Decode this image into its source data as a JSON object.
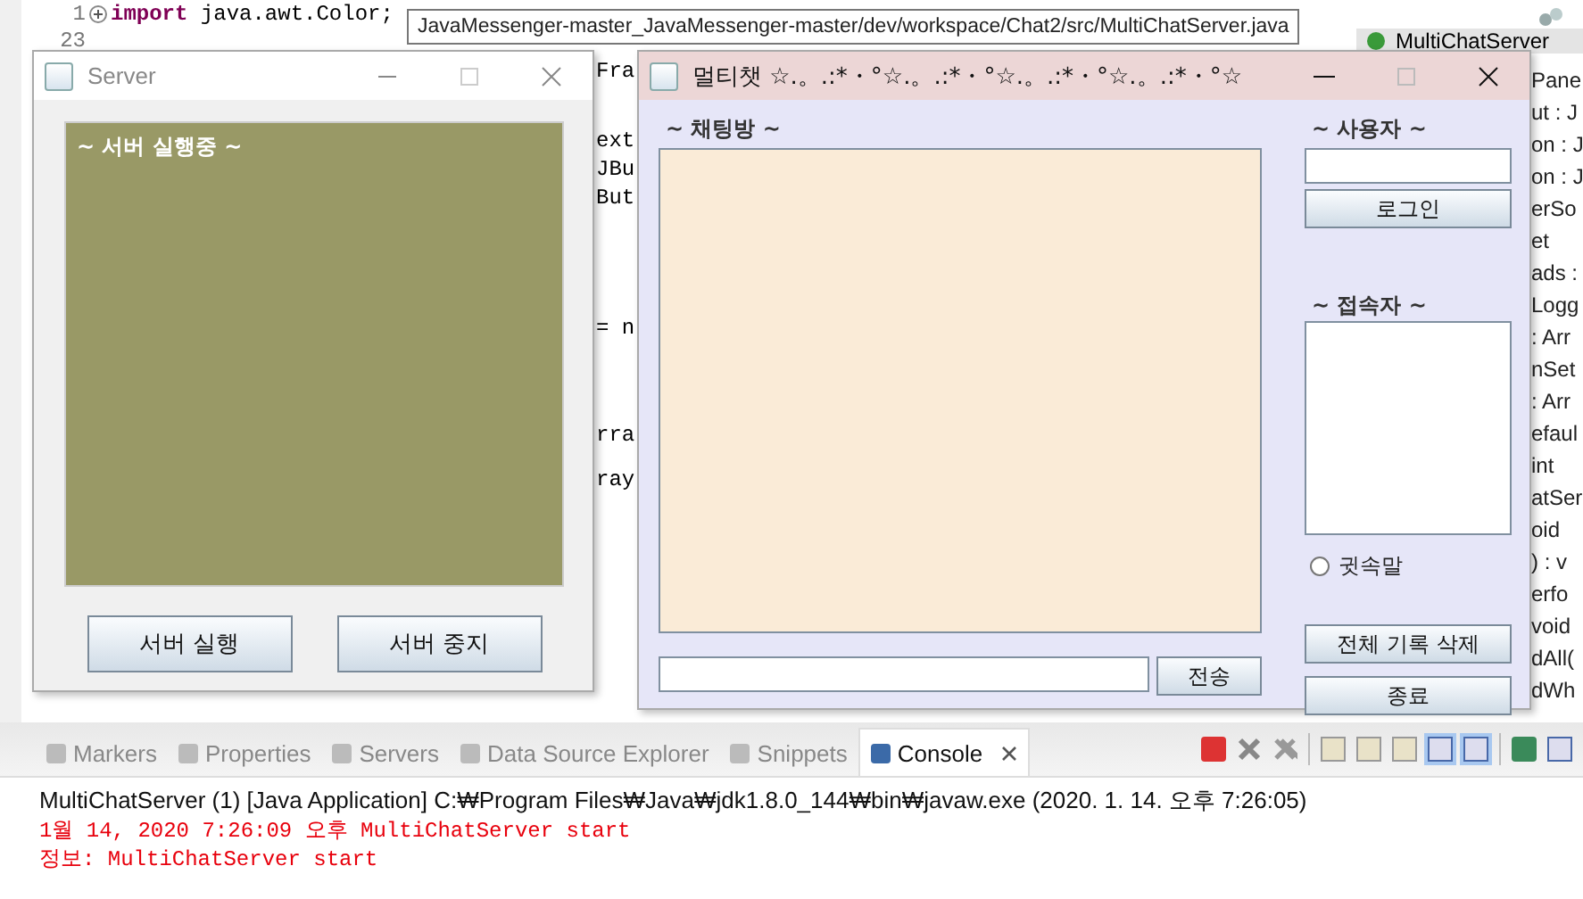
{
  "editor": {
    "lines": [
      {
        "number": "1",
        "text": "**import** java.awt.Color;"
      },
      {
        "number": "23"
      }
    ],
    "fragments": [
      "Fra",
      "ext",
      "JBu",
      "But",
      "= n",
      "rra",
      "ray"
    ]
  },
  "tooltip": "JavaMessenger-master_JavaMessenger-master/dev/workspace/Chat2/src/MultiChatServer.java",
  "outline": {
    "title": "MultiChatServer",
    "items": [
      "Pane",
      "ut : J",
      "on : J",
      "on : J",
      "erSo",
      "et",
      "ads :",
      "Logg",
      ": Arr",
      "nSet",
      ": Arr",
      "efaul",
      "int",
      "atSer",
      "oid",
      ") : v",
      "erfo",
      "void",
      "dAll(",
      "dWh"
    ]
  },
  "server_window": {
    "title": "Server",
    "status": "~ 서버 실행중 ~",
    "buttons": [
      "서버 실행",
      "서버 중지"
    ]
  },
  "chat_window": {
    "title": "멀티챗 ☆.。.:*・°☆.。.:*・°☆.。.:*・°☆.。.:*・°☆",
    "chat_label": "~ 채팅방 ~",
    "send_button": "전송",
    "user_label": "~ 사용자 ~",
    "login_button": "로그인",
    "users_label": "~ 접속자 ~",
    "whisper": {
      "label": "귓속말",
      "selected": false
    },
    "clear_button": "전체 기록 삭제",
    "exit_button": "종료"
  },
  "bottom_panel": {
    "tabs": [
      {
        "label": "Markers",
        "selected": false
      },
      {
        "label": "Properties",
        "selected": false
      },
      {
        "label": "Servers",
        "selected": false
      },
      {
        "label": "Data Source Explorer",
        "selected": false
      },
      {
        "label": "Snippets",
        "selected": false
      },
      {
        "label": "Console",
        "selected": true
      }
    ],
    "console": {
      "header": "MultiChatServer (1) [Java Application] C:₩Program Files₩Java₩jdk1.8.0_144₩bin₩javaw.exe (2020. 1. 14. 오후 7:26:05)",
      "lines": [
        "1월 14, 2020 7:26:09 오후 MultiChatServer start",
        "정보: MultiChatServer start"
      ]
    }
  }
}
